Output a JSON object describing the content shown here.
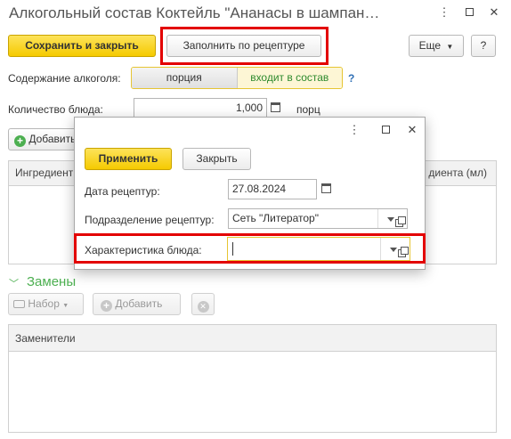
{
  "window": {
    "title": "Алкогольный состав Коктейль \"Ананасы в шампан…",
    "more_icon": "⋮",
    "maximize_icon": "square-icon",
    "close_icon": "✕"
  },
  "toolbar": {
    "save_close_label": "Сохранить и закрыть",
    "fill_recipe_label": "Заполнить по рецептуре",
    "more_label": "Еще",
    "help_label": "?"
  },
  "alcohol": {
    "label": "Содержание алкоголя:",
    "option_portion": "порция",
    "option_included": "входит в состав",
    "help": "?"
  },
  "quantity": {
    "label": "Количество блюда:",
    "value": "1,000",
    "unit": "порц"
  },
  "ingredients": {
    "add_label": "Добавить",
    "col_ingredient": "Ингредиент",
    "col_right": "диента (мл)"
  },
  "replacements": {
    "section_label": "Замены",
    "set_label": "Набор",
    "add_label": "Добавить",
    "col_substitutes": "Заменители"
  },
  "dialog": {
    "apply_label": "Применить",
    "close_label": "Закрыть",
    "date_label": "Дата рецептур:",
    "date_value": "27.08.2024",
    "division_label": "Подразделение рецептур:",
    "division_value": "Сеть \"Литератор\"",
    "characteristic_label": "Характеристика блюда:",
    "characteristic_value": ""
  },
  "colors": {
    "highlight": "#e30000",
    "primary_button": "#f5ca00",
    "section_green": "#4caf50"
  }
}
